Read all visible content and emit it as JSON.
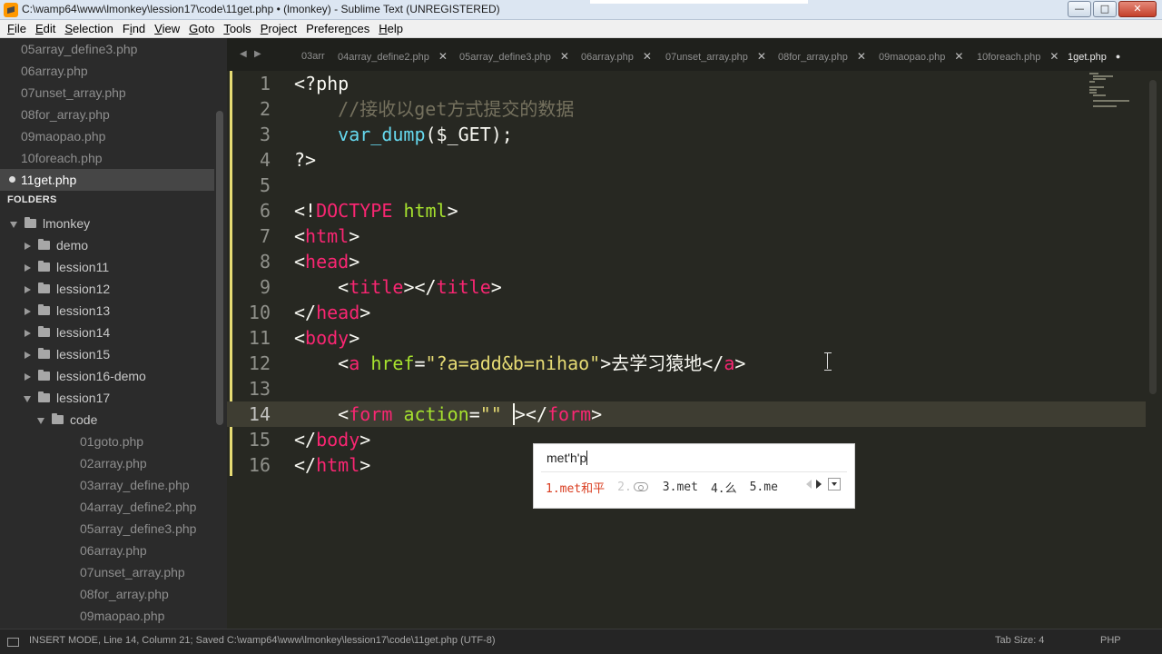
{
  "window": {
    "title": "C:\\wamp64\\www\\lmonkey\\lession17\\code\\11get.php • (lmonkey) - Sublime Text (UNREGISTERED)",
    "buttons": [
      "—",
      "□",
      "✕"
    ]
  },
  "menu": [
    {
      "pre": "",
      "u": "F",
      "post": "ile"
    },
    {
      "pre": "",
      "u": "E",
      "post": "dit"
    },
    {
      "pre": "",
      "u": "S",
      "post": "election"
    },
    {
      "pre": "F",
      "u": "i",
      "post": "nd"
    },
    {
      "pre": "",
      "u": "V",
      "post": "iew"
    },
    {
      "pre": "",
      "u": "G",
      "post": "oto"
    },
    {
      "pre": "",
      "u": "T",
      "post": "ools"
    },
    {
      "pre": "",
      "u": "P",
      "post": "roject"
    },
    {
      "pre": "Prefere",
      "u": "n",
      "post": "ces"
    },
    {
      "pre": "",
      "u": "H",
      "post": "elp"
    }
  ],
  "sidebar": {
    "open_files": [
      "05array_define3.php",
      "06array.php",
      "07unset_array.php",
      "08for_array.php",
      "09maopao.php",
      "10foreach.php",
      "11get.php"
    ],
    "active_open_file": "11get.php",
    "folders_heading": "FOLDERS",
    "root": "lmonkey",
    "folders": [
      "demo",
      "lession11",
      "lession12",
      "lession13",
      "lession14",
      "lession15",
      "lession16-demo",
      "lession17"
    ],
    "subfolder": "code",
    "files": [
      "01goto.php",
      "02array.php",
      "03array_define.php",
      "04array_define2.php",
      "05array_define3.php",
      "06array.php",
      "07unset_array.php",
      "08for_array.php",
      "09maopao.php"
    ]
  },
  "tabs": [
    "03arr",
    "04array_define2.php",
    "05array_define3.php",
    "06array.php",
    "07unset_array.php",
    "08for_array.php",
    "09maopao.php",
    "10foreach.php",
    "1get.php"
  ],
  "active_tab": "1get.php",
  "editor": {
    "line_numbers": [
      "1",
      "2",
      "3",
      "4",
      "5",
      "6",
      "7",
      "8",
      "9",
      "10",
      "11",
      "12",
      "13",
      "14",
      "15",
      "16"
    ],
    "current_line": "14",
    "lines": [
      "<?php",
      "    //接收以get方式提交的数据",
      "    var_dump($_GET);",
      "?>",
      "",
      "<!DOCTYPE html>",
      "<html>",
      "<head>",
      "    <title></title>",
      "</head>",
      "<body>",
      "    <a href=\"?a=add&b=nihao\">去学习猿地</a>",
      "",
      "    <form action=\"\" ></form>",
      "</body>",
      "</html>"
    ]
  },
  "ime": {
    "input": "met'h'p",
    "candidates": [
      "1.met和平",
      "2.",
      "3.met",
      "4.么",
      "5.me"
    ]
  },
  "status": {
    "text": "INSERT MODE, Line 14, Column 21; Saved C:\\wamp64\\www\\lmonkey\\lession17\\code\\11get.php (UTF-8)",
    "tab_size": "Tab Size: 4",
    "syntax": "PHP"
  }
}
